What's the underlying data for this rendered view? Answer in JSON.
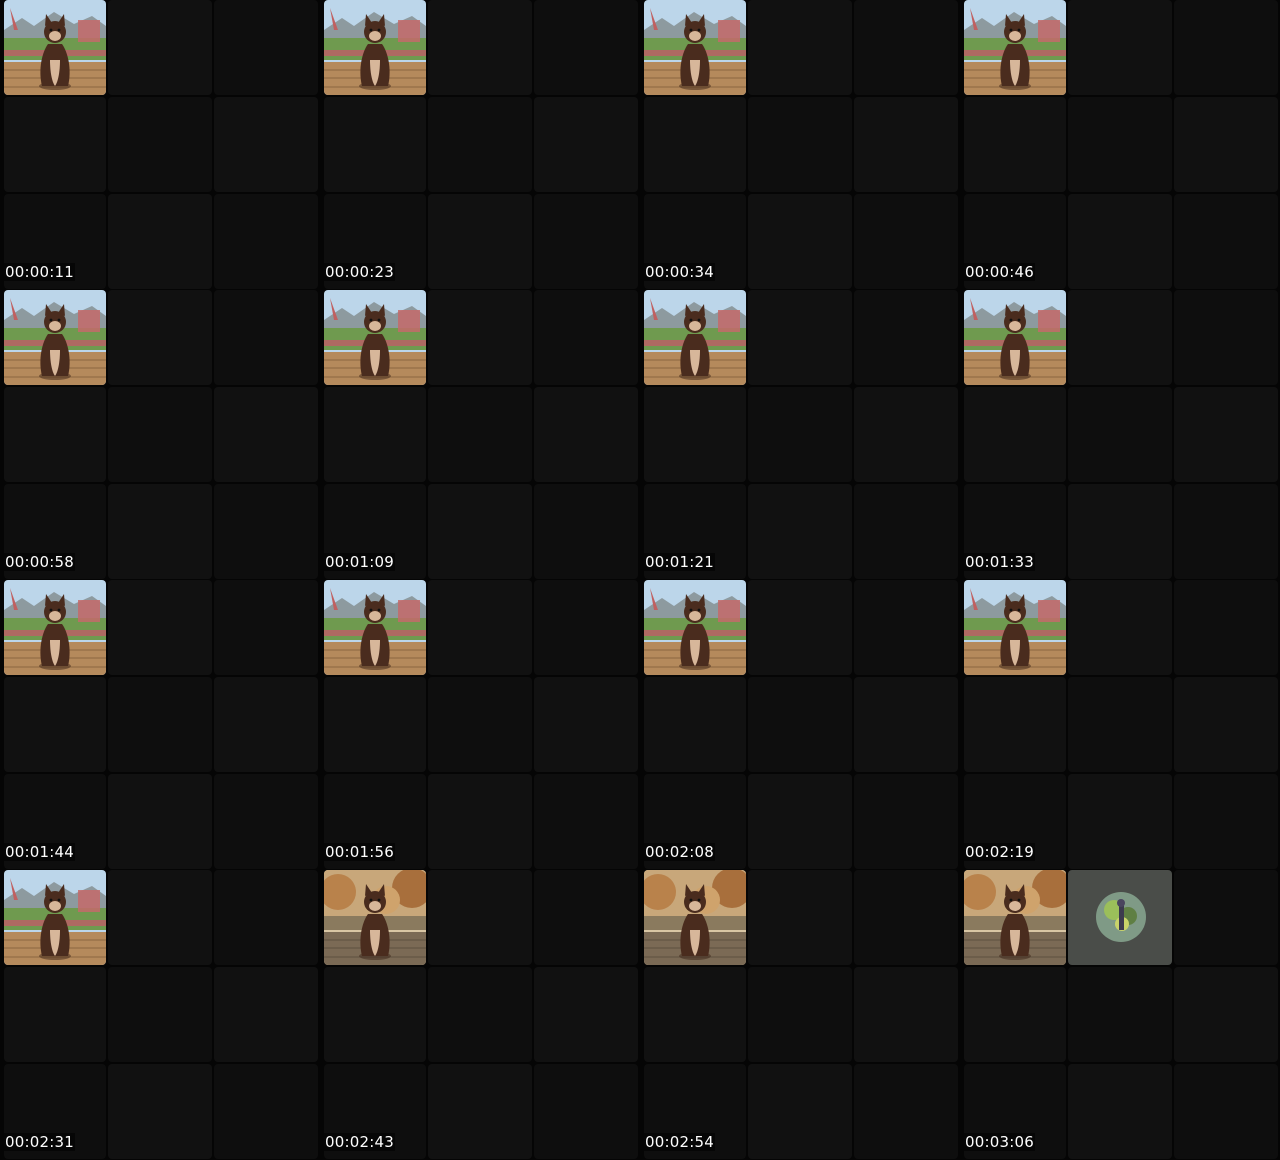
{
  "frames": [
    {
      "timestamp": "00:00:11",
      "scene": "garden",
      "has_avatar": false
    },
    {
      "timestamp": "00:00:23",
      "scene": "garden",
      "has_avatar": false
    },
    {
      "timestamp": "00:00:34",
      "scene": "garden",
      "has_avatar": false
    },
    {
      "timestamp": "00:00:46",
      "scene": "garden",
      "has_avatar": false
    },
    {
      "timestamp": "00:00:58",
      "scene": "garden",
      "has_avatar": false
    },
    {
      "timestamp": "00:01:09",
      "scene": "garden",
      "has_avatar": false
    },
    {
      "timestamp": "00:01:21",
      "scene": "garden",
      "has_avatar": false
    },
    {
      "timestamp": "00:01:33",
      "scene": "garden",
      "has_avatar": false
    },
    {
      "timestamp": "00:01:44",
      "scene": "garden",
      "has_avatar": false
    },
    {
      "timestamp": "00:01:56",
      "scene": "garden",
      "has_avatar": false
    },
    {
      "timestamp": "00:02:08",
      "scene": "garden",
      "has_avatar": false
    },
    {
      "timestamp": "00:02:19",
      "scene": "garden",
      "has_avatar": false
    },
    {
      "timestamp": "00:02:31",
      "scene": "garden",
      "has_avatar": false
    },
    {
      "timestamp": "00:02:43",
      "scene": "autumn",
      "has_avatar": false
    },
    {
      "timestamp": "00:02:54",
      "scene": "autumn",
      "has_avatar": false
    },
    {
      "timestamp": "00:03:06",
      "scene": "autumn",
      "has_avatar": true
    }
  ],
  "colors": {
    "background": "#050505",
    "tile": "#0e0e0e",
    "avatar_tile": "#4a4d49",
    "timestamp_text": "#ffffff"
  },
  "icons": {
    "thumbnail": "cat-figurine-thumbnail",
    "avatar": "participant-avatar-icon"
  }
}
